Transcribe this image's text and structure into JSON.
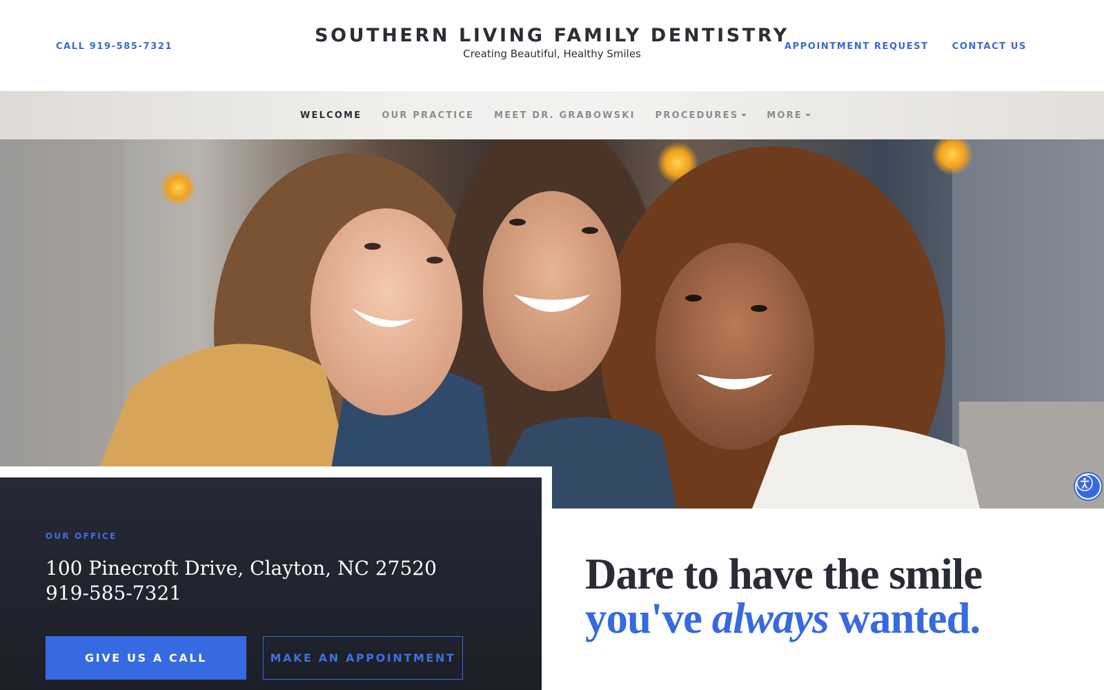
{
  "header": {
    "call_label": "CALL 919-585-7321",
    "brand_title": "SOUTHERN LIVING FAMILY DENTISTRY",
    "brand_tagline": "Creating Beautiful, Healthy Smiles",
    "links": [
      {
        "label": "APPOINTMENT REQUEST"
      },
      {
        "label": "CONTACT US"
      }
    ]
  },
  "nav": {
    "items": [
      {
        "label": "WELCOME",
        "active": true
      },
      {
        "label": "OUR PRACTICE"
      },
      {
        "label": "MEET DR. GRABOWSKI"
      },
      {
        "label": "PROCEDURES",
        "dropdown": true
      },
      {
        "label": "MORE",
        "dropdown": true
      }
    ]
  },
  "hero": {
    "accessibility_icon": "accessibility-icon"
  },
  "office": {
    "label": "OUR OFFICE",
    "address": "100 Pinecroft Drive, Clayton, NC 27520",
    "phone": "919-585-7321",
    "primary_button": "GIVE US A CALL",
    "secondary_button": "MAKE AN APPOINTMENT"
  },
  "headline": {
    "line1": "Dare to have the smile",
    "line2_pre": "you've ",
    "line2_em": "always",
    "line2_post": " wanted."
  },
  "colors": {
    "accent": "#3769e0",
    "dark": "#23252d",
    "panel": "#22242f"
  }
}
